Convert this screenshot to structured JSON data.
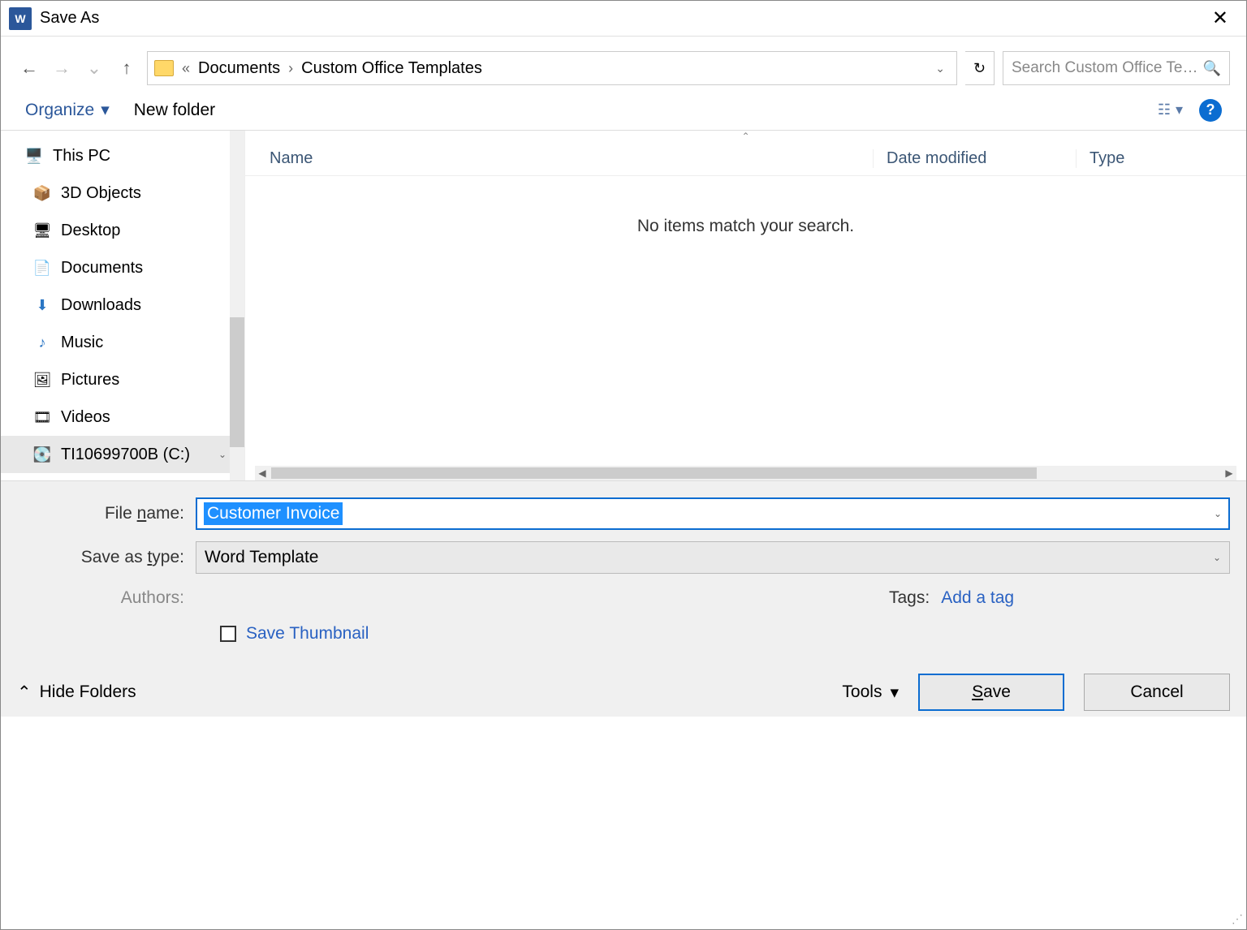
{
  "title": "Save As",
  "breadcrumb": {
    "prefix": "«",
    "items": [
      "Documents",
      "Custom Office Templates"
    ]
  },
  "search": {
    "placeholder": "Search Custom Office Templa..."
  },
  "toolbar": {
    "organize": "Organize",
    "new_folder": "New folder"
  },
  "tree": {
    "root": "This PC",
    "items": [
      "3D Objects",
      "Desktop",
      "Documents",
      "Downloads",
      "Music",
      "Pictures",
      "Videos",
      "TI10699700B (C:)"
    ]
  },
  "columns": {
    "name": "Name",
    "date": "Date modified",
    "type": "Type"
  },
  "empty_message": "No items match your search.",
  "form": {
    "file_name_label_pre": "File ",
    "file_name_label_ul": "n",
    "file_name_label_post": "ame:",
    "file_name_value": "Customer Invoice",
    "save_type_label_pre": "Save as ",
    "save_type_label_ul": "t",
    "save_type_label_post": "ype:",
    "save_type_value": "Word Template",
    "authors_label": "Authors:",
    "tags_label": "Tags:",
    "add_tag": "Add a tag",
    "save_thumbnail": "Save Thumbnail"
  },
  "footer": {
    "hide_folders": "Hide Folders",
    "tools_pre": "Too",
    "tools_ul": "l",
    "tools_post": "s",
    "save_ul": "S",
    "save_post": "ave",
    "cancel": "Cancel"
  }
}
